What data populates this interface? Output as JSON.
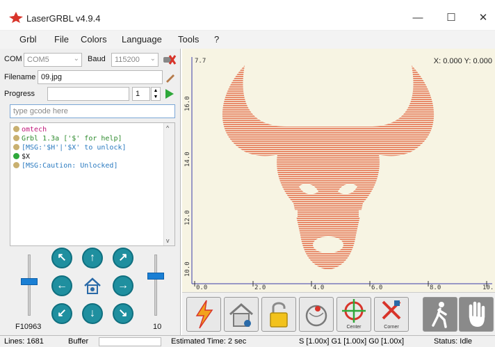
{
  "window": {
    "title": "LaserGRBL v4.9.4",
    "minimize": "—",
    "maximize": "☐",
    "close": "✕"
  },
  "menu": [
    "Grbl",
    "File",
    "Colors",
    "Language",
    "Tools",
    "?"
  ],
  "connection": {
    "com_label": "COM",
    "com_value": "COM5",
    "baud_label": "Baud",
    "baud_value": "115200"
  },
  "file": {
    "filename_label": "Filename",
    "filename_value": "09.jpg",
    "progress_label": "Progress",
    "progress_copies": "1"
  },
  "gcode_input": {
    "placeholder": "type gcode here"
  },
  "console_lines": [
    {
      "text": "omtech",
      "color": "#c0187a"
    },
    {
      "text": "Grbl 1.3a ['$' for help]",
      "color": "#2e8b2e"
    },
    {
      "text": "[MSG:'$H'|'$X' to unlock]",
      "color": "#2a7ac0"
    },
    {
      "text": "$X",
      "color": "#111111"
    },
    {
      "text": "[MSG:Caution: Unlocked]",
      "color": "#2a7ac0"
    }
  ],
  "jog": {
    "speed_label": "F10963",
    "step_label": "10"
  },
  "canvas": {
    "coordinates": "X: 0.000 Y: 0.000",
    "y_ticks": [
      "7.7",
      "16.0",
      "14.0",
      "12.0",
      "10.0"
    ],
    "x_ticks": [
      "0.0",
      "2.0",
      "4.0",
      "6.0",
      "8.0",
      "10."
    ],
    "y_tick_values": [
      7.7,
      16.0,
      14.0,
      12.0,
      10.0
    ]
  },
  "toolbar": {
    "center_caption": "Center",
    "corner_caption": "Corner"
  },
  "status": {
    "lines": "Lines:  1681",
    "buffer": "Buffer",
    "estimated": "Estimated Time:  2 sec",
    "overrides": "S [1.00x] G1 [1.00x] G0 [1.00x]",
    "state": "Status:  Idle"
  },
  "colors": {
    "accent": "#1a7fd4",
    "jog": "#1f8f9f",
    "engraving": "#e88a6a",
    "canvas_bg": "#f7f4e3"
  }
}
